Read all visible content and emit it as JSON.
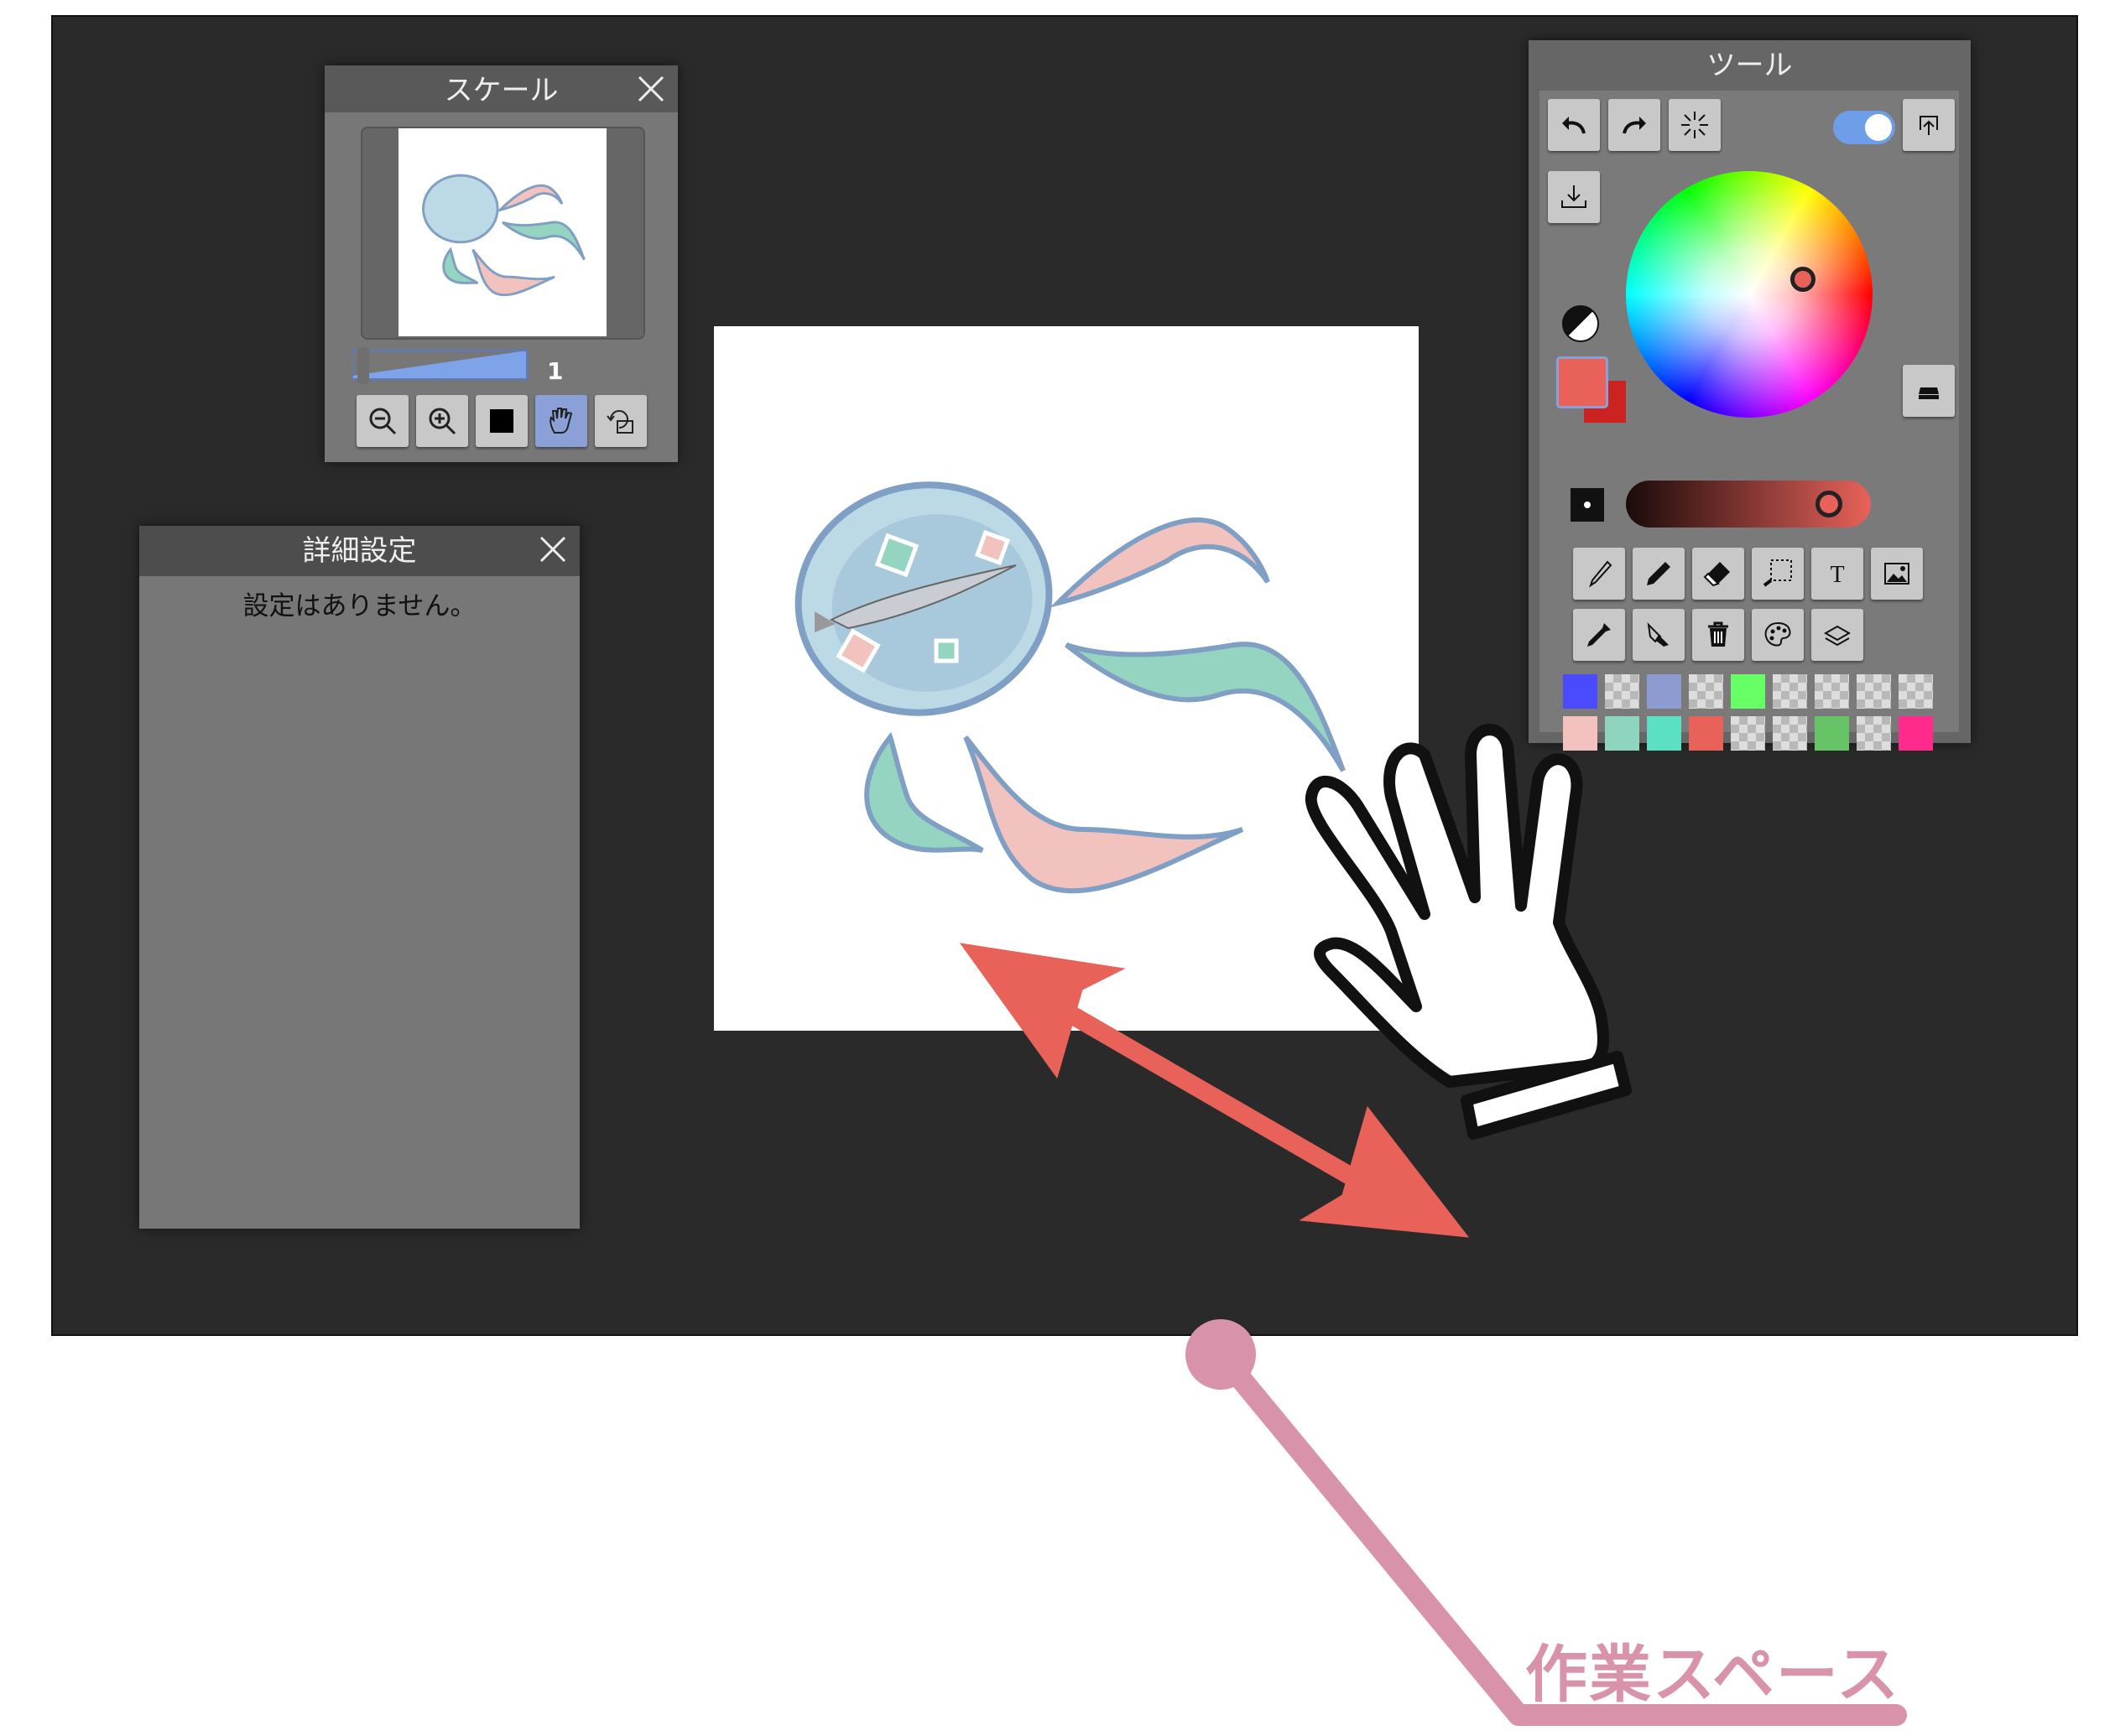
{
  "workspace": {
    "annotation_label": "作業スペース",
    "bg_color": "#2a2a2a",
    "annotation_color": "#d892a9",
    "pan_arrow_color": "#e8625a"
  },
  "scale_panel": {
    "title": "スケール",
    "zoom_value": "1",
    "zoom_fraction": 0.03,
    "buttons": [
      "zoom-out-icon",
      "zoom-in-icon",
      "fit-black-square-icon",
      "hand-pan-icon",
      "rotate-canvas-icon"
    ]
  },
  "detail_panel": {
    "title": "詳細設定",
    "message": "設定はありません。"
  },
  "tool_panel": {
    "title": "ツール",
    "toggle_on": true,
    "current_color": "#e8625a",
    "secondary_color": "#cc2222",
    "tools": [
      "brush-icon",
      "pen-icon",
      "eraser-icon",
      "selection-icon",
      "text-icon",
      "image-icon",
      "eyedropper-icon",
      "fill-bucket-icon",
      "trash-icon",
      "palette-icon",
      "layers-icon"
    ],
    "palette_row1": [
      "#4a4aff",
      "checker",
      "#8e9bd0",
      "checker",
      "#66ff66",
      "checker",
      "checker",
      "checker",
      "checker"
    ],
    "palette_row2": [
      "#f2c2bf",
      "#8fd4bf",
      "#5ce0c4",
      "#e8625a",
      "checker",
      "checker",
      "#66c466",
      "checker",
      "#ff2a8c"
    ]
  }
}
